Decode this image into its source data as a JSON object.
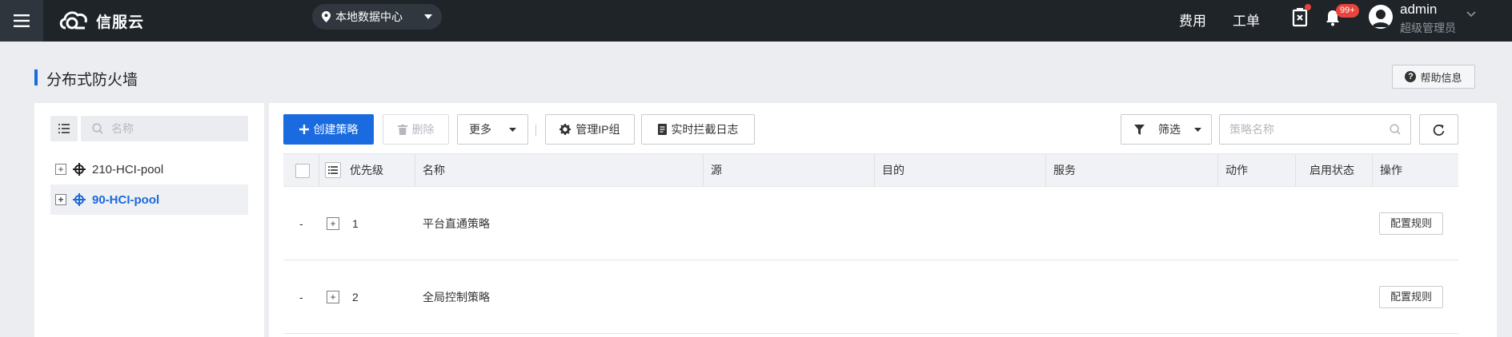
{
  "topbar": {
    "brand": "信服云",
    "datacenter": "本地数据中心",
    "links": {
      "fee": "费用",
      "ticket": "工单"
    },
    "notification_badge": "99+",
    "user": {
      "name": "admin",
      "role": "超级管理员"
    }
  },
  "page": {
    "title": "分布式防火墙",
    "help_label": "帮助信息"
  },
  "tree": {
    "search_placeholder": "名称",
    "items": [
      {
        "label": "210-HCI-pool",
        "selected": false
      },
      {
        "label": "90-HCI-pool",
        "selected": true
      }
    ]
  },
  "toolbar": {
    "create": "创建策略",
    "delete": "删除",
    "more": "更多",
    "manage_ip": "管理IP组",
    "block_log": "实时拦截日志",
    "filter": "筛选",
    "search_placeholder": "策略名称"
  },
  "table": {
    "columns": {
      "priority": "优先级",
      "name": "名称",
      "source": "源",
      "dest": "目的",
      "service": "服务",
      "action": "动作",
      "status": "启用状态",
      "ops": "操作"
    },
    "rows": [
      {
        "dash": "-",
        "priority": "1",
        "name": "平台直通策略",
        "op": "配置规则"
      },
      {
        "dash": "-",
        "priority": "2",
        "name": "全局控制策略",
        "op": "配置规则"
      }
    ]
  },
  "colors": {
    "accent": "#1a6ae0",
    "topbar": "#1f2429",
    "badge": "#e8443b"
  }
}
